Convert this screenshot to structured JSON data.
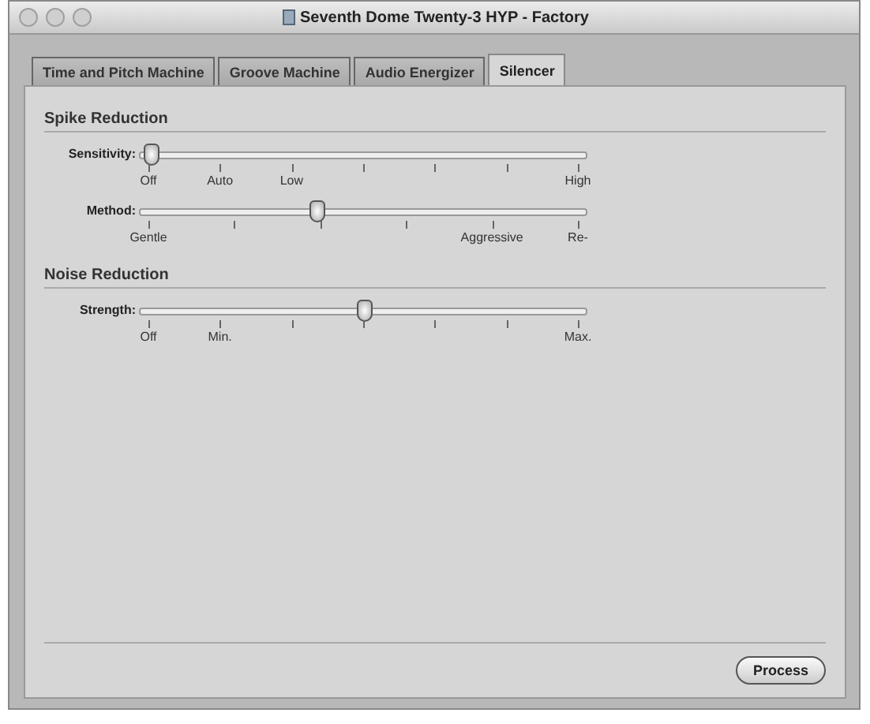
{
  "window": {
    "title": "Seventh Dome Twenty-3 HYP - Factory"
  },
  "tabs": [
    {
      "label": "Time and Pitch Machine",
      "selected": false
    },
    {
      "label": "Groove Machine",
      "selected": false
    },
    {
      "label": "Audio Energizer",
      "selected": false
    },
    {
      "label": "Silencer",
      "selected": true
    }
  ],
  "sections": [
    {
      "title": "Spike Reduction",
      "sliders": [
        {
          "label": "Sensitivity:",
          "level": 0,
          "ticks": [
            {
              "kind": "labeled",
              "label": "Off"
            },
            {
              "kind": "labeled",
              "label": "Auto"
            },
            {
              "kind": "labeled",
              "label": "Low"
            },
            {
              "kind": "plain"
            },
            {
              "kind": "plain"
            },
            {
              "kind": "plain"
            },
            {
              "kind": "labeled",
              "label": "High"
            }
          ]
        },
        {
          "label": "Method:",
          "level": 0.39,
          "ticks": [
            {
              "kind": "labeled",
              "label": "Gentle"
            },
            {
              "kind": "plain"
            },
            {
              "kind": "plain"
            },
            {
              "kind": "plain"
            },
            {
              "kind": "labeled",
              "label": "Aggressive"
            },
            {
              "kind": "labeled",
              "label": "Re-"
            }
          ]
        }
      ]
    },
    {
      "title": "Noise Reduction",
      "sliders": [
        {
          "label": "Strength:",
          "level": 0.5,
          "ticks": [
            {
              "kind": "labeled",
              "label": "Off"
            },
            {
              "kind": "labeled",
              "label": "Min."
            },
            {
              "kind": "plain"
            },
            {
              "kind": "plain"
            },
            {
              "kind": "plain"
            },
            {
              "kind": "plain"
            },
            {
              "kind": "labeled",
              "label": "Max."
            }
          ]
        }
      ]
    }
  ],
  "buttons": [
    {
      "label": "Process"
    }
  ]
}
